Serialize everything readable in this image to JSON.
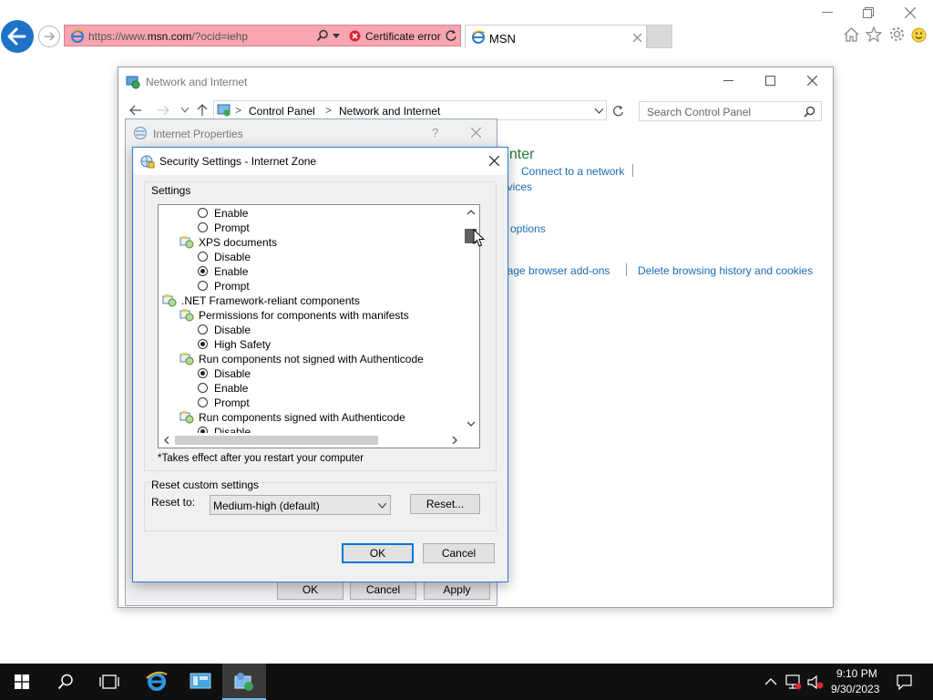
{
  "browser": {
    "url_prefix": "https://www.",
    "url_domain": "msn.com",
    "url_suffix": "/?ocid=iehp",
    "certificate_error": "Certificate error",
    "tab_title": "MSN"
  },
  "control_panel": {
    "title": "Network and Internet",
    "breadcrumb": [
      "Control Panel",
      "Network and Internet"
    ],
    "search_placeholder": "Search Control Panel",
    "heading_fragment": "enter",
    "link_connect": "Connect to a network",
    "link_devices_fragment": "evices",
    "link_options_fragment": "g options",
    "link_addons_fragment": "nage browser add-ons",
    "link_delete_history": "Delete browsing history and cookies"
  },
  "internet_properties": {
    "title": "Internet Properties",
    "help": "?",
    "ok": "OK",
    "cancel": "Cancel",
    "apply": "Apply"
  },
  "security_settings": {
    "title": "Security Settings - Internet Zone",
    "settings_label": "Settings",
    "footnote": "*Takes effect after you restart your computer",
    "reset_group_label": "Reset custom settings",
    "reset_to_label": "Reset to:",
    "reset_value": "Medium-high (default)",
    "reset_button": "Reset...",
    "ok": "OK",
    "cancel": "Cancel",
    "items": [
      {
        "type": "radio",
        "label": "Enable",
        "checked": false
      },
      {
        "type": "radio",
        "label": "Prompt",
        "checked": false
      },
      {
        "type": "group",
        "label": "XPS documents"
      },
      {
        "type": "radio",
        "label": "Disable",
        "checked": false
      },
      {
        "type": "radio",
        "label": "Enable",
        "checked": true
      },
      {
        "type": "radio",
        "label": "Prompt",
        "checked": false
      },
      {
        "type": "group0",
        "label": ".NET Framework-reliant components"
      },
      {
        "type": "group",
        "label": "Permissions for components with manifests"
      },
      {
        "type": "radio",
        "label": "Disable",
        "checked": false
      },
      {
        "type": "radio",
        "label": "High Safety",
        "checked": true
      },
      {
        "type": "group",
        "label": "Run components not signed with Authenticode"
      },
      {
        "type": "radio",
        "label": "Disable",
        "checked": true
      },
      {
        "type": "radio",
        "label": "Enable",
        "checked": false
      },
      {
        "type": "radio",
        "label": "Prompt",
        "checked": false
      },
      {
        "type": "group",
        "label": "Run components signed with Authenticode"
      },
      {
        "type": "radio",
        "label": "Disable",
        "checked": true
      }
    ]
  },
  "taskbar": {
    "time": "9:10 PM",
    "date": "9/30/2023"
  },
  "colors": {
    "accent_blue": "#1e72c8",
    "cert_error_bg": "#f7a5b0",
    "link_blue": "#1a6cb8",
    "taskbar": "#101010"
  }
}
